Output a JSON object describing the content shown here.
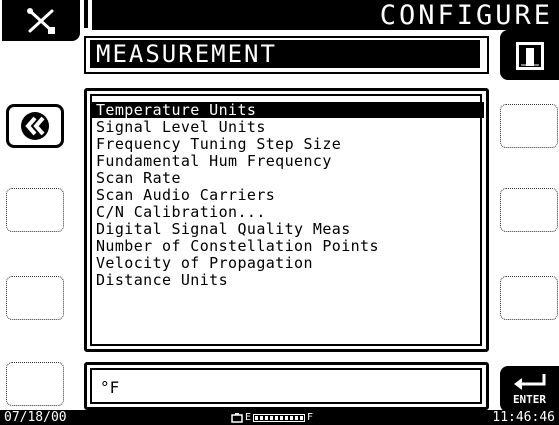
{
  "header": {
    "title": "CONFIGURE",
    "section": "MEASUREMENT"
  },
  "menu": {
    "items": [
      "Temperature Units",
      "Signal Level Units",
      "Frequency Tuning Step Size",
      "Fundamental Hum Frequency",
      "Scan Rate",
      "Scan Audio Carriers",
      "C/N Calibration...",
      "Digital Signal Quality Meas",
      "Number of Constellation Points",
      "Velocity of Propagation",
      "Distance Units"
    ],
    "selected_index": 0
  },
  "value": {
    "text": "°F"
  },
  "enter_label": "ENTER",
  "status": {
    "date": "07/18/00",
    "time": "11:46:46",
    "battery_empty": "E",
    "battery_full": "F"
  },
  "icons": {
    "tools": "tools-icon",
    "meter": "meter-icon",
    "back": "double-chevron-left-icon",
    "enter": "enter-arrow-icon",
    "battery": "battery-icon"
  }
}
